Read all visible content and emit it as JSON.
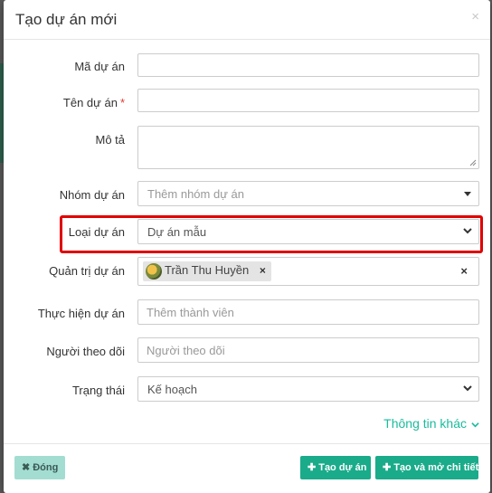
{
  "dialog": {
    "title": "Tạo dự án mới",
    "close_glyph": "×"
  },
  "form": {
    "code": {
      "label": "Mã dự án",
      "value": "",
      "placeholder": ""
    },
    "name": {
      "label": "Tên dự án",
      "required_mark": "*",
      "value": "",
      "placeholder": ""
    },
    "description": {
      "label": "Mô tả",
      "value": "",
      "placeholder": ""
    },
    "group": {
      "label": "Nhóm dự án",
      "placeholder": "Thêm nhóm dự án"
    },
    "type": {
      "label": "Loại dự án",
      "selected": "Dự án mẫu"
    },
    "admins": {
      "label": "Quản trị dự án",
      "tags": [
        {
          "name": "Trần Thu Huyền",
          "remove_glyph": "×"
        }
      ],
      "clear_glyph": "×"
    },
    "members": {
      "label": "Thực hiện dự án",
      "placeholder": "Thêm thành viên"
    },
    "followers": {
      "label": "Người theo dõi",
      "placeholder": "Người theo dõi"
    },
    "status": {
      "label": "Trạng thái",
      "selected": "Kế hoạch"
    }
  },
  "more_info_link": "Thông tin khác",
  "footer": {
    "close_label": "Đóng",
    "create_label": "Tạo dự án",
    "create_detail_label": "Tạo và mở chi tiết"
  },
  "colors": {
    "accent": "#1aab8a",
    "highlight_border": "#e00000",
    "close_button_bg": "#a3ddd2"
  },
  "icons": {
    "close_button": "times-icon",
    "create": "plus-icon",
    "more_info": "chevron-down-icon"
  }
}
